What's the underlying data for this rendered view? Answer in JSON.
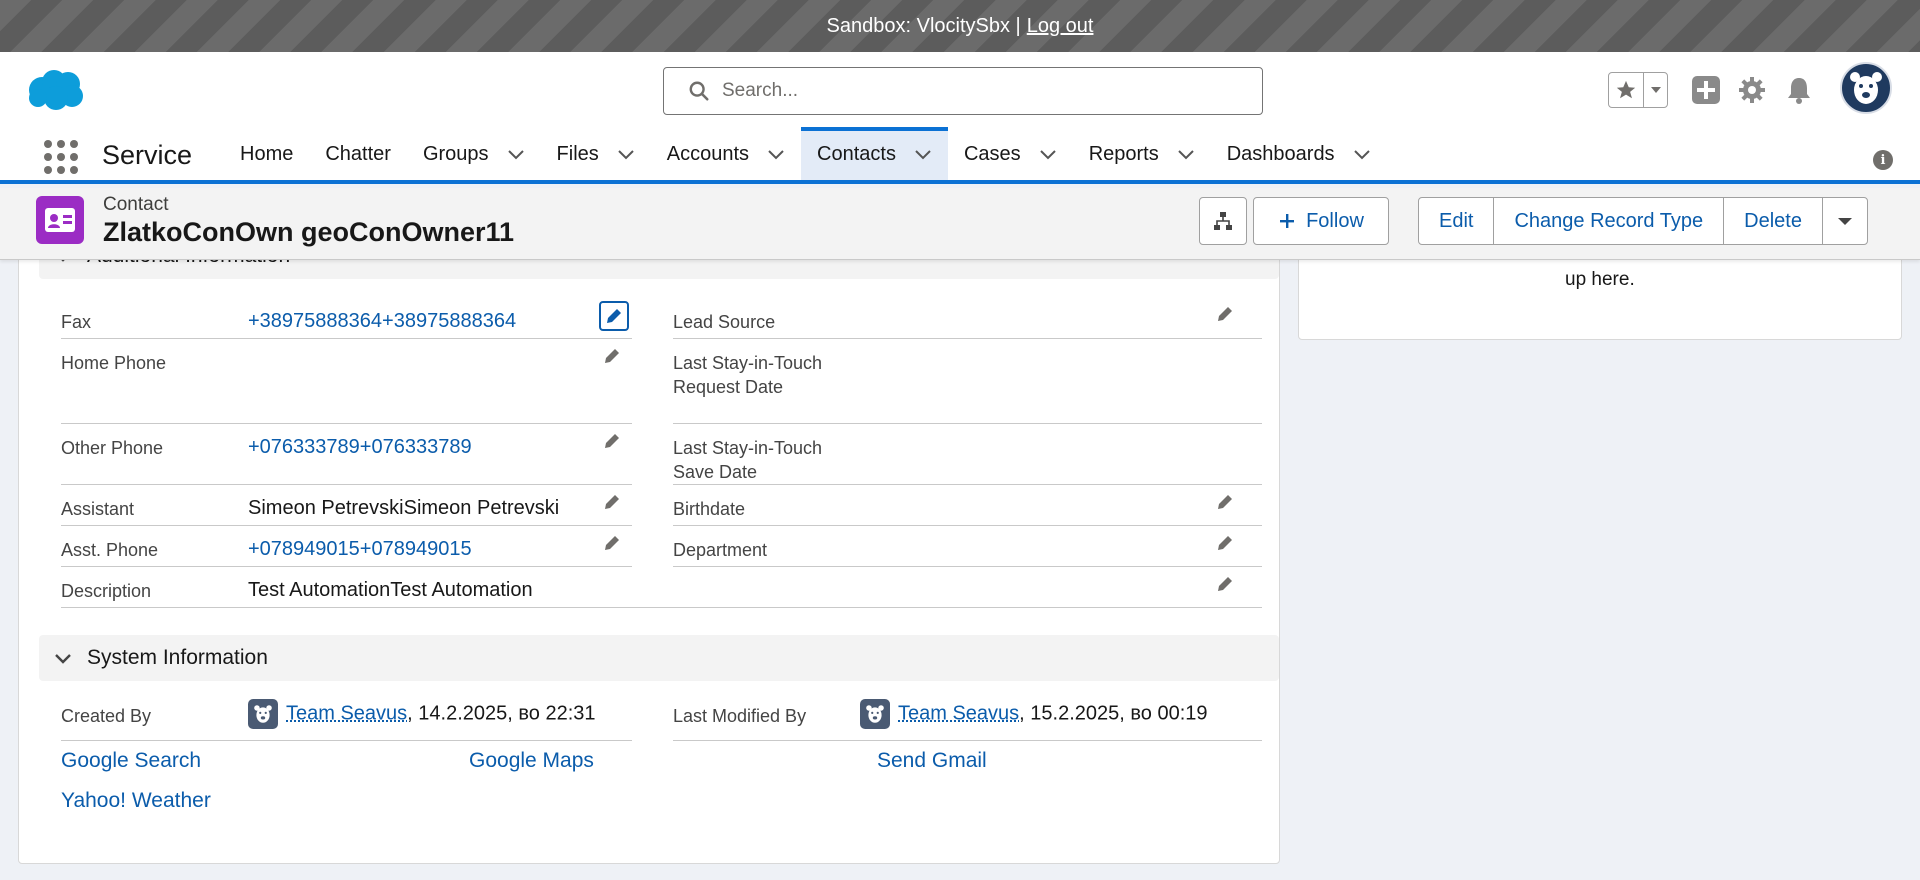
{
  "sandbox": {
    "text": "Sandbox: VlocitySbx |",
    "logout": "Log out"
  },
  "search": {
    "placeholder": "Search..."
  },
  "app": {
    "name": "Service"
  },
  "nav": [
    {
      "label": "Home",
      "has_menu": false
    },
    {
      "label": "Chatter",
      "has_menu": false
    },
    {
      "label": "Groups",
      "has_menu": true
    },
    {
      "label": "Files",
      "has_menu": true
    },
    {
      "label": "Accounts",
      "has_menu": true
    },
    {
      "label": "Contacts",
      "has_menu": true,
      "active": true
    },
    {
      "label": "Cases",
      "has_menu": true
    },
    {
      "label": "Reports",
      "has_menu": true
    },
    {
      "label": "Dashboards",
      "has_menu": true
    }
  ],
  "record": {
    "type": "Contact",
    "name": "ZlatkoConOwn geoConOwner11",
    "follow": "Follow",
    "actions": [
      "Edit",
      "Change Record Type",
      "Delete"
    ]
  },
  "side_panel": {
    "text": "up here."
  },
  "additional_section": {
    "title": "Additional Information"
  },
  "fields": {
    "fax_label": "Fax",
    "fax_value": "+38975888364+38975888364",
    "lead_source_label": "Lead Source",
    "home_phone_label": "Home Phone",
    "last_stay_request_label": "Last Stay-in-Touch Request Date",
    "other_phone_label": "Other Phone",
    "other_phone_value": "+076333789+076333789",
    "last_stay_save_label": "Last Stay-in-Touch Save Date",
    "assistant_label": "Assistant",
    "assistant_value": "Simeon PetrevskiSimeon Petrevski",
    "birthdate_label": "Birthdate",
    "asst_phone_label": "Asst. Phone",
    "asst_phone_value": "+078949015+078949015",
    "department_label": "Department",
    "description_label": "Description",
    "description_value": "Test AutomationTest Automation"
  },
  "system_section": {
    "title": "System Information",
    "created_by_label": "Created By",
    "created_by_user": "Team Seavus",
    "created_by_date": ", 14.2.2025, во 22:31",
    "modified_by_label": "Last Modified By",
    "modified_by_user": "Team Seavus",
    "modified_by_date": ", 15.2.2025, во 00:19"
  },
  "custom_links": [
    "Google Search",
    "Google Maps",
    "Send Gmail",
    "Yahoo! Weather"
  ],
  "colors": {
    "brand": "#0b71d4",
    "link": "#0b5cab",
    "contact_icon": "#9b2cc4"
  }
}
